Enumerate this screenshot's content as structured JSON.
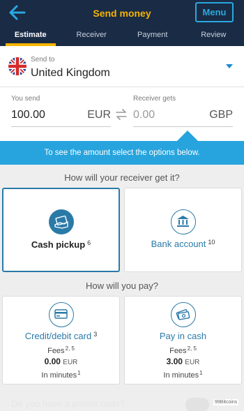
{
  "header": {
    "title": "Send money",
    "menu_label": "Menu",
    "tabs": [
      {
        "label": "Estimate",
        "active": true
      },
      {
        "label": "Receiver",
        "active": false
      },
      {
        "label": "Payment",
        "active": false
      },
      {
        "label": "Review",
        "active": false
      }
    ]
  },
  "destination": {
    "label": "Send to",
    "country": "United Kingdom"
  },
  "amounts": {
    "send_label": "You send",
    "send_value": "100.00",
    "send_currency": "EUR",
    "receive_label": "Receiver gets",
    "receive_placeholder": "0.00",
    "receive_currency": "GBP"
  },
  "banner": "To see the amount select the options below.",
  "receive_method": {
    "title": "How will your receiver get it?",
    "options": [
      {
        "label": "Cash pickup",
        "sup": "6"
      },
      {
        "label": "Bank account",
        "sup": "10"
      }
    ]
  },
  "pay_method": {
    "title": "How will you pay?",
    "options": [
      {
        "label": "Credit/debit card",
        "sup": "3",
        "fees_label": "Fees",
        "fees_sup": "2, 5",
        "fee_amount": "0.00",
        "fee_currency": "EUR",
        "time_label": "In minutes",
        "time_sup": "1"
      },
      {
        "label": "Pay in cash",
        "sup": "",
        "fees_label": "Fees",
        "fees_sup": "2, 5",
        "fee_amount": "3.00",
        "fee_currency": "EUR",
        "time_label": "In minutes",
        "time_sup": "1"
      }
    ]
  },
  "promo": "Do you have a promo code?",
  "watermark": "99Bitcoins",
  "colors": {
    "header_bg": "#1a2b45",
    "accent_yellow": "#f5b400",
    "accent_blue": "#27a4dd",
    "option_blue": "#2a7aa8"
  }
}
